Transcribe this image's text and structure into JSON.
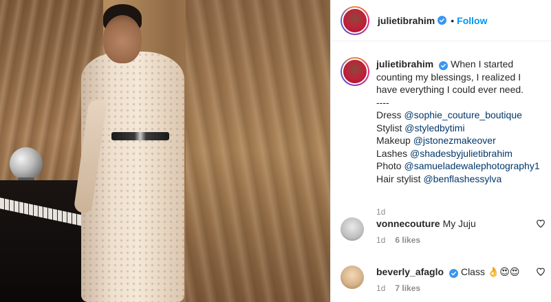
{
  "post": {
    "author": {
      "username": "julietibrahim",
      "verified": true
    },
    "follow_separator": "•",
    "follow_label": "Follow"
  },
  "caption": {
    "username": "julietibrahim",
    "lines": [
      "When I started",
      "counting my blessings, I realized I",
      "have everything I could ever need.",
      "----"
    ],
    "credits": [
      {
        "label": "Dress ",
        "mention": "@sophie_couture_boutique"
      },
      {
        "label": "Stylist ",
        "mention": "@styledbytimi"
      },
      {
        "label": "Makeup ",
        "mention": "@jstonezmakeover"
      },
      {
        "label": "Lashes ",
        "mention": "@shadesbyjulietibrahim"
      },
      {
        "label": "Photo ",
        "mention": "@samueladewalephotography1"
      },
      {
        "label": "Hair stylist ",
        "mention": "@benflashessylva"
      }
    ],
    "time": "1d"
  },
  "comments": [
    {
      "username": "vonnecouture",
      "text": "My Juju",
      "time": "1d",
      "likes": "6 likes",
      "verified": false
    },
    {
      "username": "beverly_afaglo",
      "text": "Class 👌😍😍",
      "time": "1d",
      "likes": "7 likes",
      "verified": true
    }
  ],
  "icons": {
    "verified": "verified-badge-icon",
    "heart": "heart-outline-icon"
  },
  "colors": {
    "link": "#0095f6",
    "mention": "#00376b",
    "verified": "#3897f0",
    "meta": "#8e8e8e"
  }
}
